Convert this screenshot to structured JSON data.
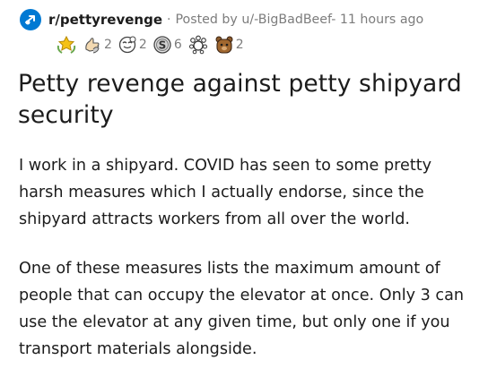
{
  "post": {
    "subreddit": "r/pettyrevenge",
    "separator": "·",
    "posted_by": "Posted by u/-BigBadBeef- 11 hours ago",
    "awards": [
      {
        "icon": "gold-wreath-award-icon",
        "count": ""
      },
      {
        "icon": "helpful-hand-award-icon",
        "count": "2"
      },
      {
        "icon": "wholesome-face-award-icon",
        "count": "2"
      },
      {
        "icon": "silver-s-award-icon",
        "count": "6"
      },
      {
        "icon": "paw-burst-award-icon",
        "count": ""
      },
      {
        "icon": "bear-face-award-icon",
        "count": "2"
      }
    ],
    "title": "Petty revenge against petty shipyard security",
    "paragraphs": [
      "I work in a shipyard. COVID has seen to some pretty harsh measures which I actually endorse, since the shipyard attracts workers from all over the world.",
      "One of these measures lists the maximum amount of people that can occupy the elevator at once. Only 3 can use the elevator at any given time, but only one if you transport materials alongside."
    ]
  },
  "colors": {
    "subreddit_icon_bg": "#0079d3",
    "meta_gray": "#7c7c7c",
    "text": "#1c1c1c"
  }
}
